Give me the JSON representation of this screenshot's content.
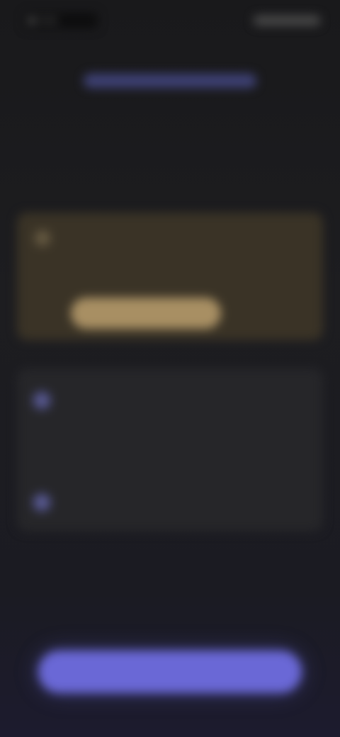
{
  "status_bar": {
    "time": "9:41"
  },
  "header": {
    "banner": "",
    "title": ""
  },
  "warning": {
    "icon": "warning-icon",
    "text": "",
    "button_label": ""
  },
  "steps": {
    "items": [
      {
        "icon": "step-icon",
        "number": "1",
        "title": "",
        "sub1": "",
        "sub2": ""
      },
      {
        "icon": "step-icon",
        "number": "2",
        "title": ""
      }
    ]
  },
  "footer": {
    "note": "",
    "primary_button_label": ""
  },
  "colors": {
    "accent": "#6a68d6",
    "warning": "#a88f63",
    "background": "#1a1a1c"
  }
}
